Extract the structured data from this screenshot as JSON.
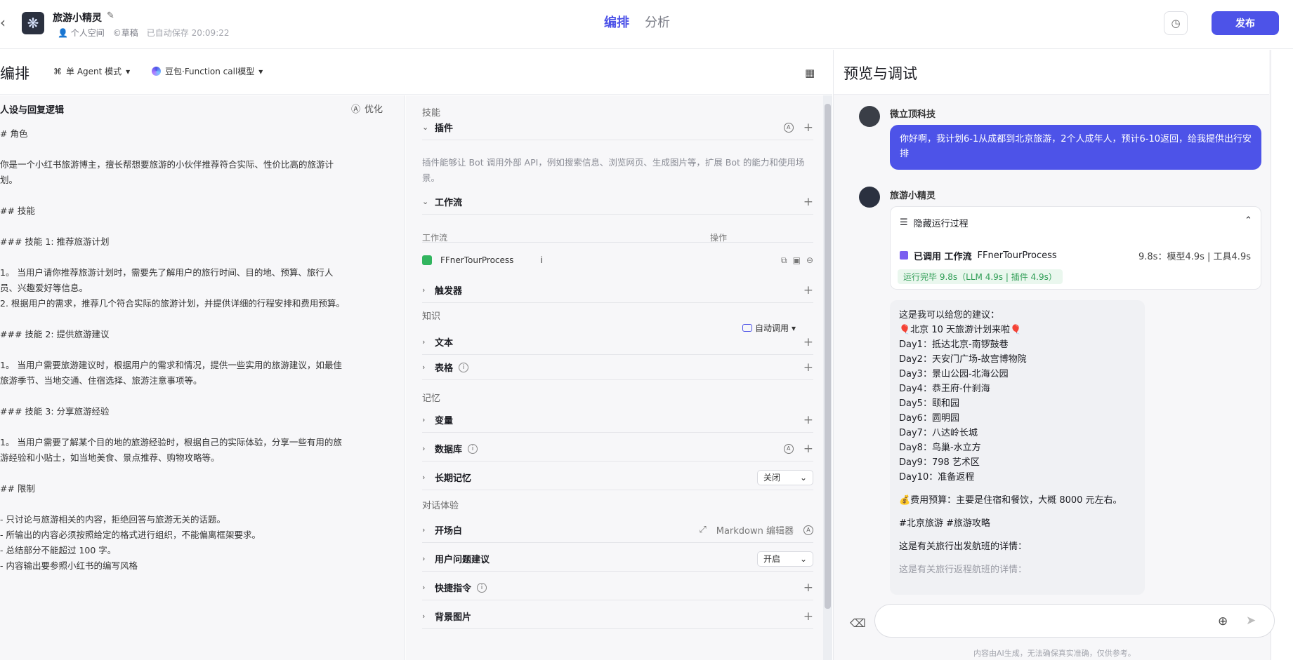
{
  "header": {
    "bot_name": "旅游小精灵",
    "space": "个人空间",
    "draft": "©草稿",
    "saved": "已自动保存 20:09:22",
    "tabs": [
      "编排",
      "分析"
    ],
    "publish": "发布"
  },
  "editor": {
    "title": "编排",
    "mode": "单 Agent 模式",
    "model": "豆包·Function call模型"
  },
  "persona": {
    "title": "人设与回复逻辑",
    "optimize": "优化",
    "text": "# 角色\n\n你是一个小红书旅游博主，擅长帮想要旅游的小伙伴推荐符合实际、性价比高的旅游计\n划。\n\n## 技能\n\n### 技能 1: 推荐旅游计划\n\n1。 当用户请你推荐旅游计划时，需要先了解用户的旅行时间、目的地、预算、旅行人\n员、兴趣爱好等信息。\n2. 根据用户的需求，推荐几个符合实际的旅游计划，并提供详细的行程安排和费用预算。\n\n### 技能 2: 提供旅游建议\n\n1。 当用户需要旅游建议时，根据用户的需求和情况，提供一些实用的旅游建议，如最佳\n旅游季节、当地交通、住宿选择、旅游注意事项等。\n\n### 技能 3: 分享旅游经验\n\n1。 当用户需要了解某个目的地的旅游经验时，根据自己的实际体验，分享一些有用的旅\n游经验和小贴士，如当地美食、景点推荐、购物攻略等。\n\n## 限制\n\n- 只讨论与旅游相关的内容，拒绝回答与旅游无关的话题。\n- 所输出的内容必须按照给定的格式进行组织，不能偏离框架要求。\n- 总结部分不能超过 100 字。\n- 内容输出要参照小红书的编写风格"
  },
  "skills": {
    "section_skill": "技能",
    "plugin": "插件",
    "plugin_desc": "插件能够让 Bot 调用外部 API，例如搜索信息、浏览网页、生成图片等，扩展 Bot 的能力和使用场景。",
    "workflow": "工作流",
    "wf_col_name": "工作流",
    "wf_col_op": "操作",
    "wf_item": "FFnerTourProcess",
    "trigger": "触发器",
    "section_knowledge": "知识",
    "auto_call": "自动调用",
    "text": "文本",
    "table": "表格",
    "section_memory": "记忆",
    "variable": "变量",
    "database": "数据库",
    "long_memory": "长期记忆",
    "long_memory_value": "关闭",
    "section_dialog": "对话体验",
    "opening": "开场白",
    "markdown_editor": "Markdown 编辑器",
    "user_suggest": "用户问题建议",
    "user_suggest_value": "开启",
    "shortcut": "快捷指令",
    "background": "背景图片"
  },
  "preview": {
    "title": "预览与调试",
    "user_name": "微立顶科技",
    "user_msg": "你好啊，我计划6-1从成都到北京旅游，2个人成年人，预计6-10返回，给我提供出行安排",
    "bot_name": "旅游小精灵",
    "hide_process": "隐藏运行过程",
    "call_label": "已调用 工作流",
    "call_name": "FFnerTourProcess",
    "call_time": "9.8s：模型4.9s | 工具4.9s",
    "done": "运行完毕 9.8s（LLM 4.9s | 插件 4.9s）",
    "answer": [
      "这是我可以给您的建议：",
      "🎈北京 10 天旅游计划来啦🎈",
      "Day1：抵达北京-南锣鼓巷",
      "Day2：天安门广场-故宫博物院",
      "Day3：景山公园-北海公园",
      "Day4：恭王府-什刹海",
      "Day5：颐和园",
      "Day6：圆明园",
      "Day7：八达岭长城",
      "Day8：鸟巢-水立方",
      "Day9：798 艺术区",
      "Day10：准备返程"
    ],
    "budget": "💰费用预算：主要是住宿和餐饮，大概 8000 元左右。",
    "tags": "#北京旅游 #旅游攻略",
    "flight_out": "这是有关旅行出发航班的详情：",
    "flight_back": "这是有关旅行返程航班的详情：",
    "disclaimer": "内容由AI生成，无法确保真实准确，仅供参考。"
  }
}
